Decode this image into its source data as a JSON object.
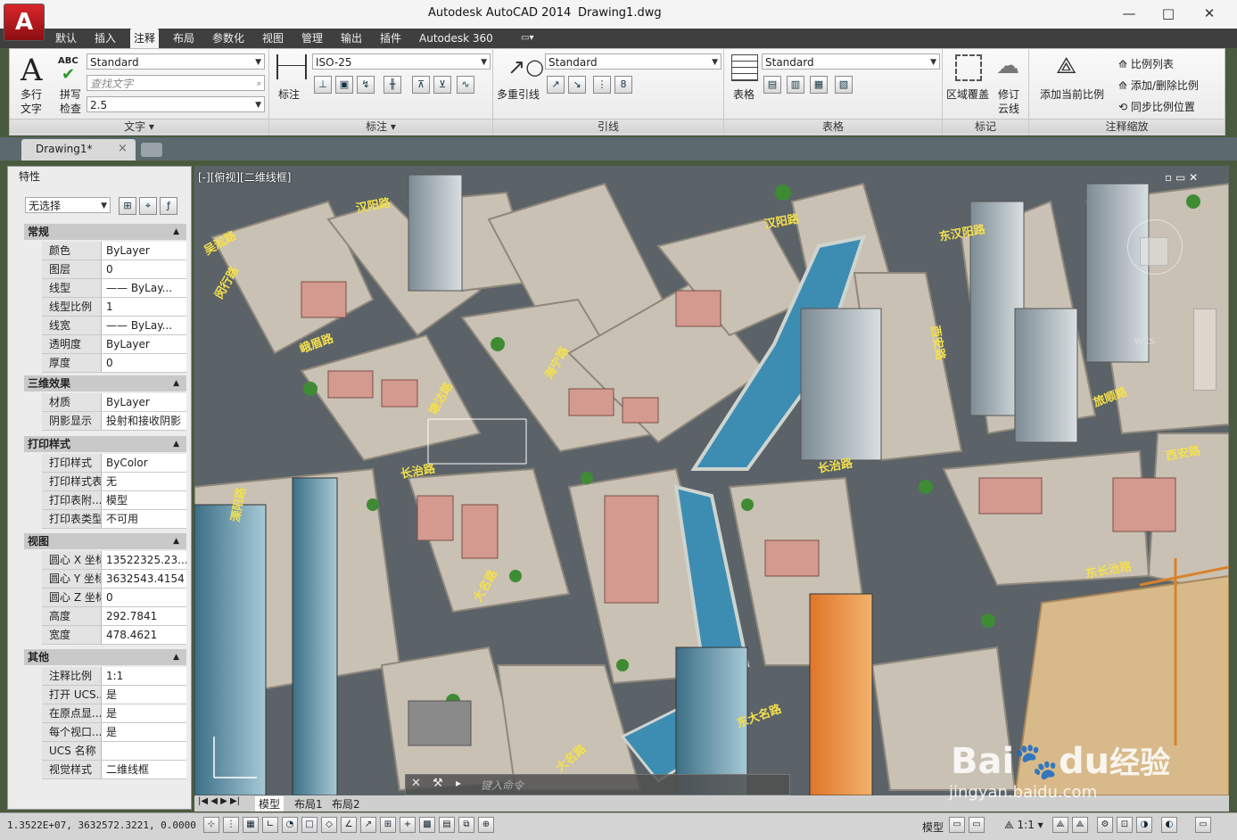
{
  "window": {
    "app_title": "Autodesk AutoCAD 2014",
    "doc_title": "Drawing1.dwg",
    "minimize": "—",
    "restore": "□",
    "close": "✕"
  },
  "menu_tabs": [
    "默认",
    "插入",
    "注释",
    "布局",
    "参数化",
    "视图",
    "管理",
    "输出",
    "插件",
    "Autodesk 360"
  ],
  "active_tab": "注释",
  "ribbon": {
    "text_panel": {
      "title": "文字",
      "multiline_label_1": "多行",
      "multiline_label_2": "文字",
      "spell_label_1": "拼写",
      "spell_label_2": "检查",
      "abc": "ABC",
      "style": "Standard",
      "find_placeholder": "查找文字",
      "height": "2.5"
    },
    "dim_panel": {
      "title": "标注",
      "dim_label": "标注",
      "style": "ISO-25"
    },
    "leader_panel": {
      "title": "引线",
      "multileader_label": "多重引线",
      "style": "Standard"
    },
    "table_panel": {
      "title": "表格",
      "table_label": "表格",
      "style": "Standard"
    },
    "markup_panel": {
      "title": "标记",
      "wipeout_label": "区域覆盖",
      "revcloud_label_1": "修订",
      "revcloud_label_2": "云线"
    },
    "scale_panel": {
      "title": "注释缩放",
      "add_current_label": "添加当前比例",
      "scale_list": "比例列表",
      "add_delete": "添加/删除比例",
      "sync": "同步比例位置"
    }
  },
  "doc_tab": {
    "name": "Drawing1*",
    "close": "×"
  },
  "properties": {
    "panel_title": "特性",
    "selection": "无选择",
    "sections": [
      {
        "title": "常规",
        "rows": [
          {
            "k": "颜色",
            "v": "ByLayer"
          },
          {
            "k": "图层",
            "v": "0"
          },
          {
            "k": "线型",
            "v": "—— ByLay..."
          },
          {
            "k": "线型比例",
            "v": "1"
          },
          {
            "k": "线宽",
            "v": "—— ByLay..."
          },
          {
            "k": "透明度",
            "v": "ByLayer"
          },
          {
            "k": "厚度",
            "v": "0"
          }
        ]
      },
      {
        "title": "三维效果",
        "rows": [
          {
            "k": "材质",
            "v": "ByLayer"
          },
          {
            "k": "阴影显示",
            "v": "投射和接收阴影"
          }
        ]
      },
      {
        "title": "打印样式",
        "rows": [
          {
            "k": "打印样式",
            "v": "ByColor"
          },
          {
            "k": "打印样式表",
            "v": "无"
          },
          {
            "k": "打印表附...",
            "v": "模型"
          },
          {
            "k": "打印表类型",
            "v": "不可用"
          }
        ]
      },
      {
        "title": "视图",
        "rows": [
          {
            "k": "圆心 X 坐标",
            "v": "13522325.23..."
          },
          {
            "k": "圆心 Y 坐标",
            "v": "3632543.4154"
          },
          {
            "k": "圆心 Z 坐标",
            "v": "0"
          },
          {
            "k": "高度",
            "v": "292.7841"
          },
          {
            "k": "宽度",
            "v": "478.4621"
          }
        ]
      },
      {
        "title": "其他",
        "rows": [
          {
            "k": "注释比例",
            "v": "1:1"
          },
          {
            "k": "打开 UCS...",
            "v": "是"
          },
          {
            "k": "在原点显...",
            "v": "是"
          },
          {
            "k": "每个视口...",
            "v": "是"
          },
          {
            "k": "UCS 名称",
            "v": ""
          },
          {
            "k": "视觉样式",
            "v": "二维线框"
          }
        ]
      }
    ]
  },
  "viewport": {
    "label": "[-][俯视][二维线框]",
    "wcs": "WCS",
    "command_placeholder": "键入命令",
    "street_labels": [
      "吴淞路",
      "汉阳路",
      "汉阳路",
      "东汉阳路",
      "西安路",
      "长治路",
      "长治路",
      "东长治路",
      "东大名路",
      "大名路",
      "大名路",
      "西安路",
      "海宁路",
      "塘沽路",
      "峨眉路",
      "闵行路",
      "旅顺路",
      "溧阳路"
    ],
    "layout_tabs": [
      "模型",
      "布局1",
      "布局2"
    ]
  },
  "status": {
    "coords": "1.3522E+07, 3632572.3221, 0.0000",
    "model": "模型",
    "scale": "1:1"
  },
  "watermark": {
    "brand": "Bai",
    "brand2": "du",
    "cn": "经验",
    "url": "jingyan.baidu.com"
  },
  "colors": {
    "accent_red": "#c4161c",
    "tab_dark": "#3f3f3f",
    "road": "#60686e",
    "building_roof": "#d9a79d"
  }
}
